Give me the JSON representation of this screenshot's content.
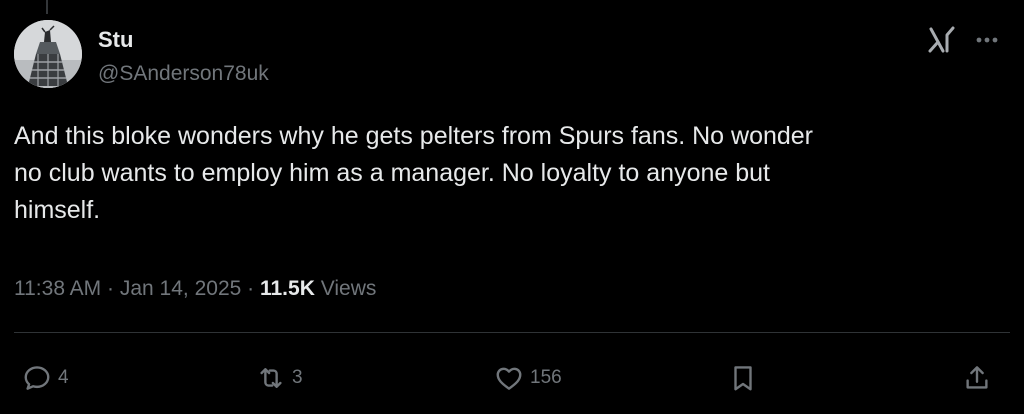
{
  "author": {
    "name": "Stu",
    "handle": "@SAnderson78uk"
  },
  "tweet": {
    "text": "And this bloke wonders why he gets pelters from Spurs fans.  No wonder\nno club wants to employ him as a manager.  No loyalty to anyone but\nhimself."
  },
  "meta": {
    "time": "11:38 AM",
    "separator": "·",
    "date": "Jan 14, 2025",
    "views_count": "11.5K",
    "views_label": "Views"
  },
  "actions": {
    "replies": "4",
    "reposts": "3",
    "likes": "156"
  },
  "icons": {
    "header": [
      "grok-icon",
      "more-icon"
    ],
    "actions": [
      "reply-icon",
      "repost-icon",
      "like-icon",
      "bookmark-icon",
      "share-icon"
    ]
  },
  "colors": {
    "background": "#000000",
    "primary_text": "#e7e9ea",
    "secondary_text": "#71767b",
    "divider": "#2f3336"
  }
}
